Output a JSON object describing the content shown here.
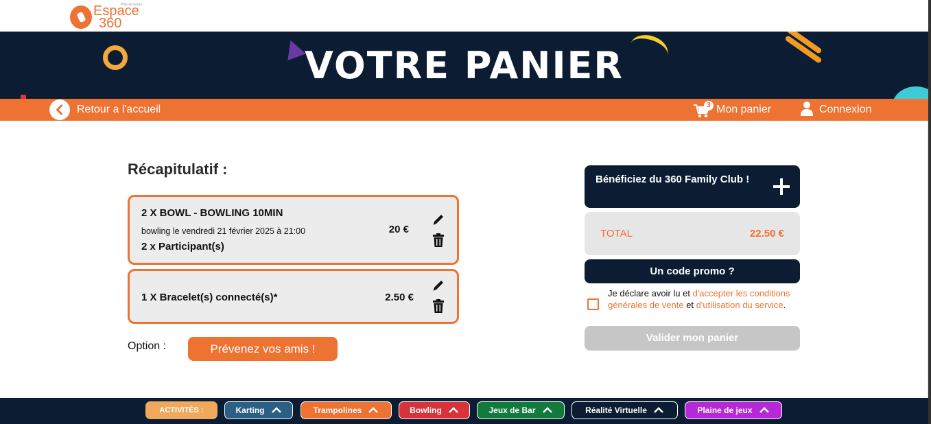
{
  "logo": {
    "word": "Espace",
    "number": "360",
    "tagline": "Pôle de loisirs"
  },
  "banner": {
    "title": "VOTRE PANIER"
  },
  "nav": {
    "back_label": "Retour a l'accueil",
    "cart_label": "Mon panier",
    "cart_count": "3",
    "login_label": "Connexion"
  },
  "recap": {
    "title": "Récapitulatif :",
    "items": [
      {
        "name": "2 X BOWL - BOWLING 10MIN",
        "detail": "bowling le vendredi 21 février 2025 à 21:00",
        "participants": "2 x Participant(s)",
        "price": "20 €"
      },
      {
        "name": "1 X Bracelet(s) connecté(s)*",
        "price": "2.50 €"
      }
    ]
  },
  "option": {
    "label": "Option :",
    "share_button": "Prévenez vos amis !"
  },
  "sidebar": {
    "family_club": "Bénéficiez du 360 Family Club !",
    "total_label": "TOTAL",
    "total_value": "22.50 €",
    "promo_button": "Un code promo ?",
    "terms_prefix": "Je déclare avoir lu et ",
    "terms_link1": "d'accepter les conditions générales de vente",
    "terms_middle": " et ",
    "terms_link2": "d'utilisation du service",
    "terms_suffix": ".",
    "terms_checked": false,
    "validate_button": "Valider mon panier"
  },
  "footer": {
    "activities_label": "ACTIVITÉS :",
    "pills": [
      {
        "label": "Karting",
        "color": "#2b5f84"
      },
      {
        "label": "Trampolines",
        "color": "#ee7232"
      },
      {
        "label": "Bowling",
        "color": "#d8323a"
      },
      {
        "label": "Jeux de Bar",
        "color": "#117a3c"
      },
      {
        "label": "Réalité Virtuelle",
        "color": "#0c1d33"
      },
      {
        "label": "Plaine de jeux",
        "color": "#b52ad6"
      }
    ]
  },
  "colors": {
    "brand_orange": "#ee7232",
    "navy": "#0c1d33",
    "grey_box": "#ececec"
  }
}
